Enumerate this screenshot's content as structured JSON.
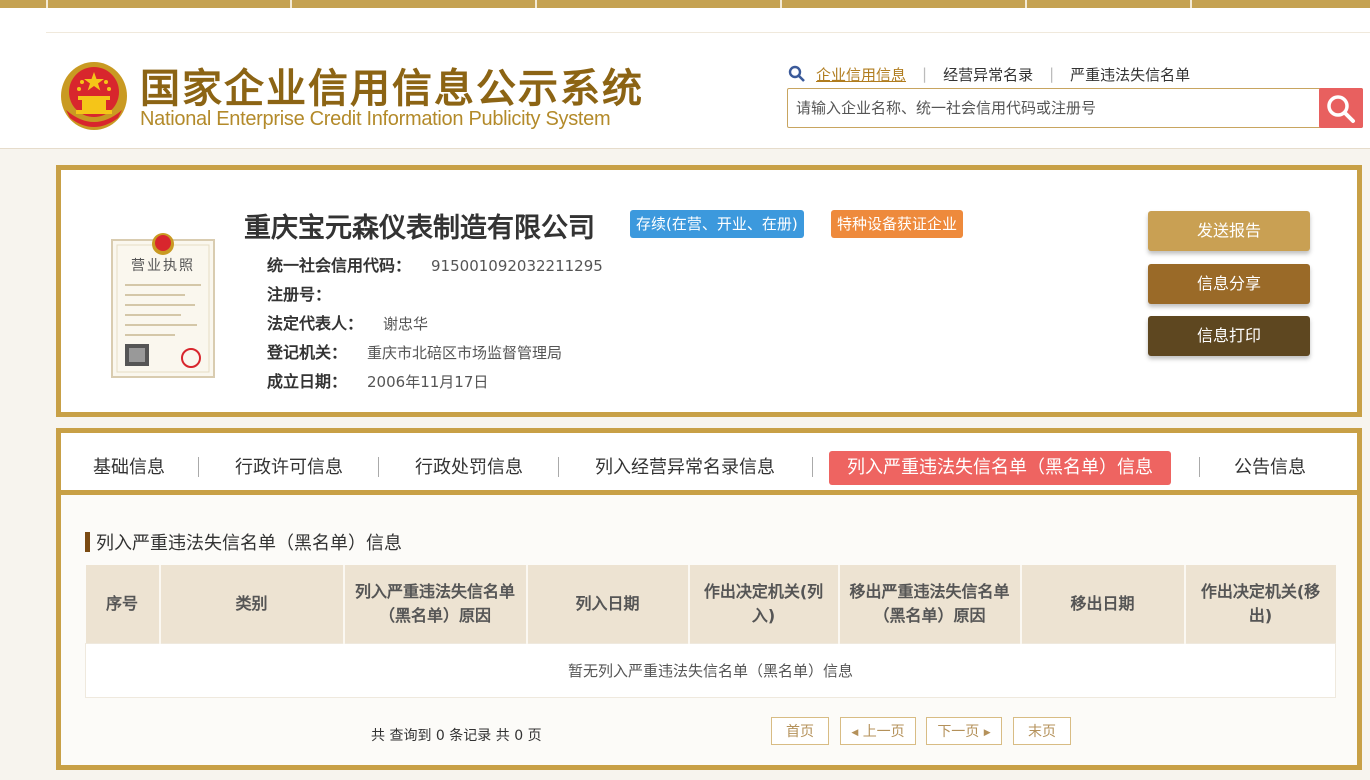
{
  "header": {
    "title_cn": "国家企业信用信息公示系统",
    "title_en": "National Enterprise Credit Information Publicity System",
    "search_links": [
      "企业信用信息",
      "经营异常名录",
      "严重违法失信名单"
    ],
    "search_placeholder": "请输入企业名称、统一社会信用代码或注册号"
  },
  "company": {
    "name": "重庆宝元森仪表制造有限公司",
    "status": "存续(在营、开业、在册)",
    "special": "特种设备获证企业",
    "license_title": "营业执照",
    "fields": [
      {
        "label": "统一社会信用代码：",
        "value": "915001092032211295"
      },
      {
        "label": "注册号：",
        "value": ""
      },
      {
        "label": "法定代表人：",
        "value": "谢忠华"
      },
      {
        "label": "登记机关：",
        "value": "重庆市北碚区市场监督管理局"
      },
      {
        "label": "成立日期：",
        "value": "2006年11月17日"
      }
    ],
    "actions": [
      "发送报告",
      "信息分享",
      "信息打印"
    ]
  },
  "tabs": [
    "基础信息",
    "行政许可信息",
    "行政处罚信息",
    "列入经营异常名录信息",
    "列入严重违法失信名单（黑名单）信息",
    "公告信息"
  ],
  "section": {
    "title": "列入严重违法失信名单（黑名单）信息",
    "columns": [
      "序号",
      "类别",
      "列入严重违法失信名单（黑名单）原因",
      "列入日期",
      "作出决定机关(列入)",
      "移出严重违法失信名单（黑名单）原因",
      "移出日期",
      "作出决定机关(移出)"
    ],
    "empty_text": "暂无列入严重违法失信名单（黑名单）信息"
  },
  "pager": {
    "prefix": "共 查询到",
    "records": "0",
    "mid": "条记录 共",
    "pages": "0",
    "suffix": "页",
    "first": "首页",
    "prev": "上一页",
    "next": "下一页",
    "last": "末页"
  },
  "colors": {
    "gold": "#c8a046",
    "brand_text": "#8c6414",
    "active_tab": "#ee6461",
    "status_badge": "#3c99dd",
    "special_badge": "#ee8a3c",
    "btn_report": "#c9a053",
    "btn_share": "#9a6a28",
    "btn_print": "#5e4720"
  },
  "icons": [
    "magnifier-icon",
    "national-emblem-icon",
    "business-license-icon"
  ]
}
